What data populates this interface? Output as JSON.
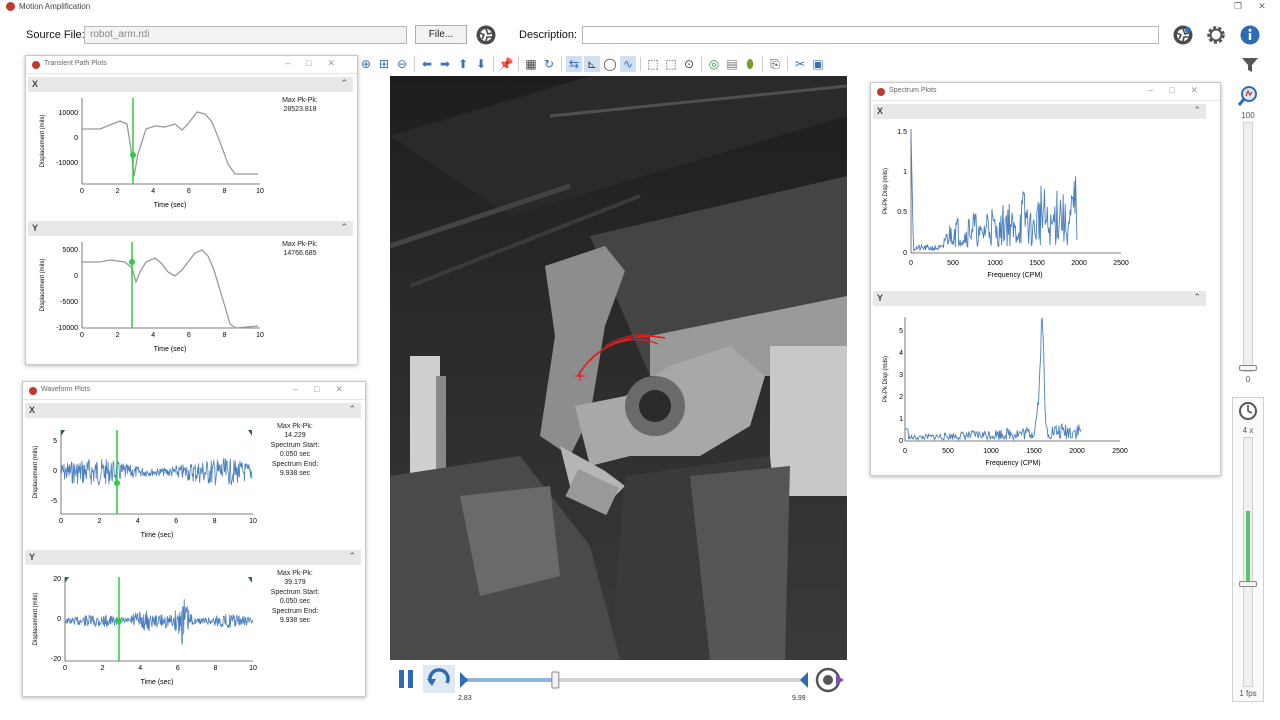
{
  "window": {
    "title": "Motion Amplification"
  },
  "header": {
    "source_file_label": "Source File:",
    "source_file_value": "robot_arm.rdi",
    "file_button": "File...",
    "description_label": "Description:",
    "description_value": ""
  },
  "icons": [
    "gear-icon",
    "info-icon",
    "filter-icon",
    "camera-lens-icon",
    "play-icon",
    "pause-icon",
    "loop-icon",
    "clock-icon",
    "zoom-icon"
  ],
  "transient_panel": {
    "title": "Transient Path Plots",
    "x": {
      "label": "X",
      "stats_label": "Max Pk-Pk:",
      "stats_value": "28523.818",
      "ylabel": "Displacement (mils)",
      "xlabel": "Time (sec)",
      "yticks": [
        "10000",
        "0",
        "-10000"
      ],
      "xticks": [
        "0",
        "2",
        "4",
        "6",
        "8",
        "10"
      ]
    },
    "y": {
      "label": "Y",
      "stats_label": "Max Pk-Pk:",
      "stats_value": "14766.685",
      "ylabel": "Displacement (mils)",
      "xlabel": "Time (sec)",
      "yticks": [
        "5000",
        "0",
        "-5000",
        "-10000"
      ],
      "xticks": [
        "0",
        "2",
        "4",
        "6",
        "8",
        "10"
      ]
    }
  },
  "waveform_panel": {
    "title": "Waveform Plots",
    "x": {
      "label": "X",
      "stat1_label": "Max Pk-Pk:",
      "stat1_value": "14.229",
      "stat2_label": "Spectrum Start:",
      "stat2_value": "0.050 sec",
      "stat3_label": "Spectrum End:",
      "stat3_value": "9.938 sec",
      "ylabel": "Displacement (mils)",
      "xlabel": "Time (sec)",
      "yticks": [
        "5",
        "0",
        "-5"
      ],
      "xticks": [
        "0",
        "2",
        "4",
        "6",
        "8",
        "10"
      ]
    },
    "y": {
      "label": "Y",
      "stat1_label": "Max Pk-Pk:",
      "stat1_value": "39.179",
      "stat2_label": "Spectrum Start:",
      "stat2_value": "0.050 sec",
      "stat3_label": "Spectrum End:",
      "stat3_value": "9.938 sec",
      "ylabel": "Displacement (mils)",
      "xlabel": "Time (sec)",
      "yticks": [
        "20",
        "0",
        "-20"
      ],
      "xticks": [
        "0",
        "2",
        "4",
        "6",
        "8",
        "10"
      ]
    }
  },
  "spectrum_panel": {
    "title": "Spectrum Plots",
    "x": {
      "label": "X",
      "ylabel": "Pk-Pk Disp (mils)",
      "xlabel": "Frequency (CPM)",
      "yticks": [
        "1.5",
        "1",
        "0.5",
        "0"
      ],
      "xticks": [
        "0",
        "500",
        "1000",
        "1500",
        "2000",
        "2500"
      ]
    },
    "y": {
      "label": "Y",
      "ylabel": "Pk-Pk Disp (mils)",
      "xlabel": "Frequency (CPM)",
      "yticks": [
        "5",
        "4",
        "3",
        "2",
        "1",
        "0"
      ],
      "xticks": [
        "0",
        "500",
        "1000",
        "1500",
        "2000",
        "2500"
      ]
    }
  },
  "playback": {
    "start_time": "2.83",
    "end_time": "9.99",
    "position_fraction": 0.27
  },
  "right_sliders": {
    "zoom_top": "100",
    "zoom_bottom": "0",
    "zoom_level_fraction": 0.0,
    "speed_top": "4 x",
    "speed_bottom": "1 fps",
    "speed_level_fraction": 0.41
  },
  "colors": {
    "accent": "#3b6fb6",
    "cursor": "#2ecc40",
    "trace": "#4a7fc1",
    "path": "#999999"
  }
}
